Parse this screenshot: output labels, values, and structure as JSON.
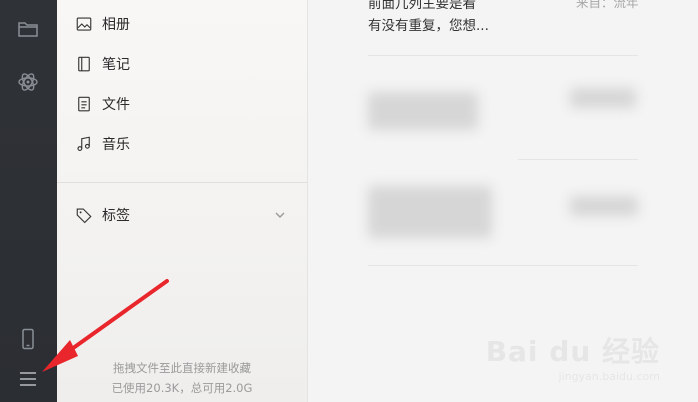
{
  "sidebar": {
    "items": [
      {
        "label": "相册",
        "icon": "image-icon"
      },
      {
        "label": "笔记",
        "icon": "notebook-icon"
      },
      {
        "label": "文件",
        "icon": "document-icon"
      },
      {
        "label": "音乐",
        "icon": "music-icon"
      }
    ],
    "tags_label": "标签",
    "footer_hint": "拖拽文件至此直接新建收藏",
    "storage_text": "已使用20.3K，总可用2.0G"
  },
  "content": {
    "first_note": {
      "line1": "前面几列主要是看",
      "line2": "有没有重复，您想...",
      "source": "来自：流年"
    }
  },
  "watermark": {
    "brand": "Bai du 经验",
    "url": "jingyan.baidu.com"
  },
  "colors": {
    "rail": "#2f3237",
    "arrow": "#e8262b"
  }
}
